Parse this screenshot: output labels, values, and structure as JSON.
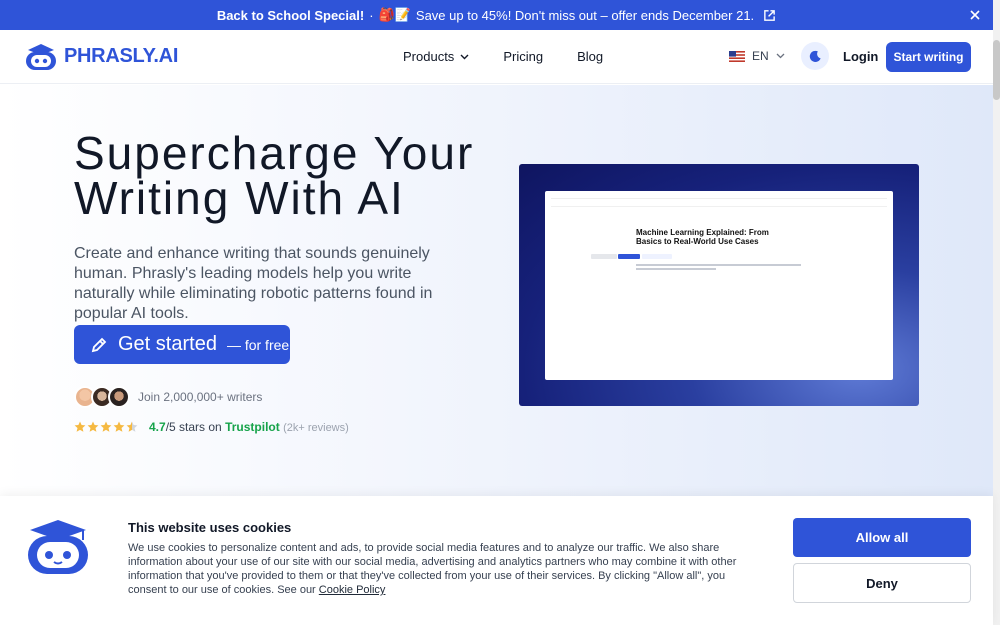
{
  "promo": {
    "bold": "Back to School Special!",
    "separator": "·",
    "emoji": "🎒📝",
    "text": "Save up to 45%! Don't miss out – offer ends December 21."
  },
  "header": {
    "logo_text": "PHRASLY.AI",
    "nav": {
      "products": "Products",
      "pricing": "Pricing",
      "blog": "Blog"
    },
    "language": "EN",
    "login": "Login",
    "start_writing": "Start writing"
  },
  "hero": {
    "title_line1": "Supercharge Your",
    "title_line2": "Writing With AI",
    "subtitle": "Create and enhance writing that sounds genuinely human. Phrasly's leading models help you write naturally while eliminating robotic patterns found in popular AI tools.",
    "cta_main": "Get started",
    "cta_suffix": "— for free",
    "join_text": "Join 2,000,000+ writers",
    "rating_value": "4.7",
    "rating_suffix": "/5 stars on",
    "trustpilot": "Trustpilot",
    "reviews": "(2k+ reviews)",
    "stars_count": 4.5,
    "doc_title": "Machine Learning Explained: From Basics to Real-World Use Cases"
  },
  "cookie": {
    "title": "This website uses cookies",
    "body": "We use cookies to personalize content and ads, to provide social media features and to analyze our traffic. We also share information about your use of our site with our social media, advertising and analytics partners who may combine it with other information that you've provided to them or that they've collected from your use of their services. By clicking \"Allow all\", you consent to our use of cookies. See our",
    "policy_link": "Cookie Policy",
    "allow": "Allow all",
    "deny": "Deny"
  },
  "colors": {
    "brand": "#2f54d8",
    "trustpilot": "#16a34a",
    "star": "#f5b942"
  }
}
